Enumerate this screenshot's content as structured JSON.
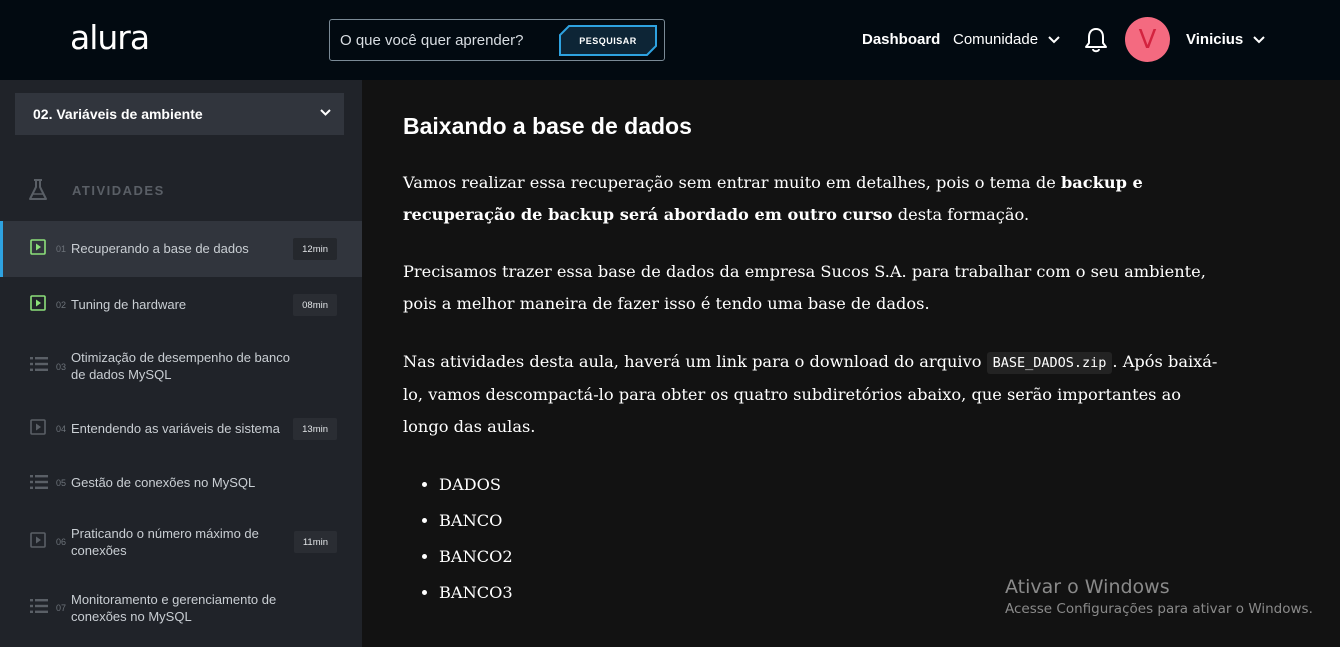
{
  "header": {
    "logo": "alura",
    "search_placeholder": "O que você quer aprender?",
    "search_button": "PESQUISAR",
    "nav_dashboard": "Dashboard",
    "nav_comunidade": "Comunidade",
    "avatar_initial": "V",
    "user_name": "Vinicius",
    "colors": {
      "background": "#020a11",
      "avatar": "#f46a80",
      "search_accent": "#2ea2e0"
    }
  },
  "sidebar": {
    "section_title": "02. Variáveis de ambiente",
    "activities_label": "ATIVIDADES",
    "items": [
      {
        "number": "01",
        "label": "Recuperando a base de dados",
        "duration": "12min",
        "icon": "video-done-icon",
        "active": true
      },
      {
        "number": "02",
        "label": "Tuning de hardware",
        "duration": "08min",
        "icon": "video-done-icon",
        "active": false
      },
      {
        "number": "03",
        "label": "Otimização de desempenho de banco de dados MySQL",
        "duration": "",
        "icon": "list-icon",
        "active": false
      },
      {
        "number": "04",
        "label": "Entendendo as variáveis de sistema",
        "duration": "13min",
        "icon": "video-icon",
        "active": false
      },
      {
        "number": "05",
        "label": "Gestão de conexões no MySQL",
        "duration": "",
        "icon": "list-icon",
        "active": false
      },
      {
        "number": "06",
        "label": "Praticando o número máximo de conexões",
        "duration": "11min",
        "icon": "video-icon",
        "active": false
      },
      {
        "number": "07",
        "label": "Monitoramento e gerenciamento de conexões no MySQL",
        "duration": "",
        "icon": "list-icon",
        "active": false
      }
    ]
  },
  "content": {
    "title": "Baixando a base de dados",
    "p1_start": "Vamos realizar essa recuperação sem entrar muito em detalhes, pois o tema de ",
    "p1_bold": "backup e recuperação de backup será abordado em outro curso",
    "p1_end": " desta formação.",
    "p2": "Precisamos trazer essa base de dados da empresa Sucos S.A. para trabalhar com o seu ambiente, pois a melhor maneira de fazer isso é tendo uma base de dados.",
    "p3_start": "Nas atividades desta aula, haverá um link para o download do arquivo ",
    "p3_code": "BASE_DADOS.zip",
    "p3_end": ". Após baixá-lo, vamos descompactá-lo para obter os quatro subdiretórios abaixo, que serão importantes ao longo das aulas.",
    "list": [
      "DADOS",
      "BANCO",
      "BANCO2",
      "BANCO3"
    ]
  },
  "watermark": {
    "title": "Ativar o Windows",
    "subtitle": "Acesse Configurações para ativar o Windows."
  }
}
